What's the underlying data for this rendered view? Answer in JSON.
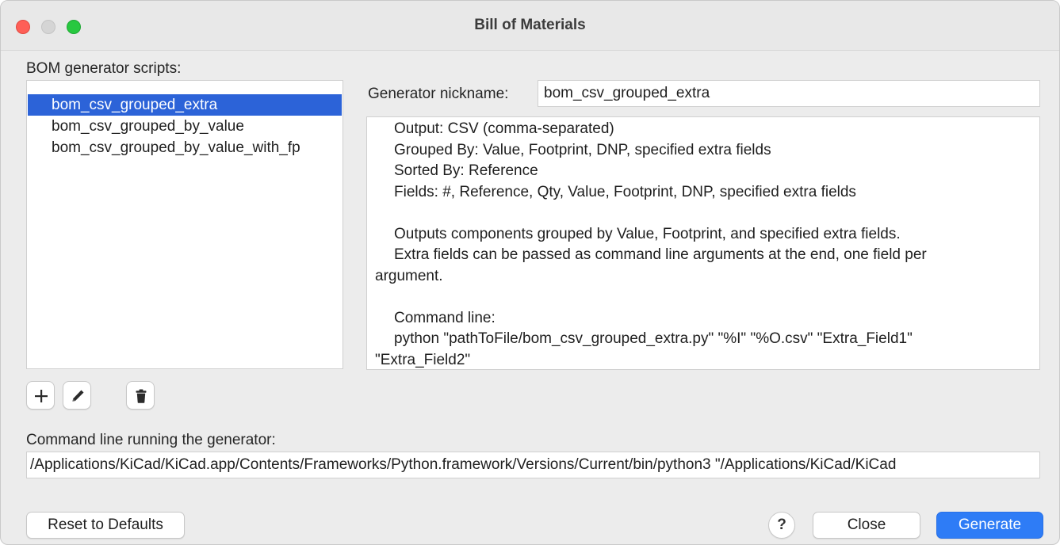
{
  "window": {
    "title": "Bill of Materials"
  },
  "scripts_panel": {
    "label": "BOM generator scripts:",
    "items": [
      {
        "label": "bom_csv_grouped_extra",
        "selected": true
      },
      {
        "label": "bom_csv_grouped_by_value",
        "selected": false
      },
      {
        "label": "bom_csv_grouped_by_value_with_fp",
        "selected": false
      }
    ],
    "buttons": {
      "add_icon": "plus-icon",
      "edit_icon": "pencil-icon",
      "delete_icon": "trash-icon"
    }
  },
  "generator": {
    "nickname_label": "Generator nickname:",
    "nickname_value": "bom_csv_grouped_extra",
    "description_lines": [
      {
        "text": "Output: CSV (comma-separated)",
        "indent": true
      },
      {
        "text": "Grouped By: Value, Footprint, DNP, specified extra fields",
        "indent": true
      },
      {
        "text": "Sorted By: Reference",
        "indent": true
      },
      {
        "text": "Fields: #, Reference, Qty, Value, Footprint, DNP, specified extra fields",
        "indent": true
      },
      {
        "text": "",
        "indent": false
      },
      {
        "text": "Outputs components grouped by Value, Footprint, and specified extra fields.",
        "indent": true
      },
      {
        "text": "Extra fields can be passed as command line arguments at the end, one field per",
        "indent": true
      },
      {
        "text": "argument.",
        "indent": false
      },
      {
        "text": "",
        "indent": false
      },
      {
        "text": "Command line:",
        "indent": true
      },
      {
        "text": "python \"pathToFile/bom_csv_grouped_extra.py\" \"%I\" \"%O.csv\" \"Extra_Field1\"",
        "indent": true
      },
      {
        "text": "\"Extra_Field2\"",
        "indent": false
      }
    ]
  },
  "command": {
    "label": "Command line running the generator:",
    "value": "/Applications/KiCad/KiCad.app/Contents/Frameworks/Python.framework/Versions/Current/bin/python3 \"/Applications/KiCad/KiCad"
  },
  "footer": {
    "reset_label": "Reset to Defaults",
    "help_label": "?",
    "close_label": "Close",
    "generate_label": "Generate"
  },
  "colors": {
    "selection": "#2c63d8",
    "primary_button": "#2e7cf6",
    "traffic_close": "#fe5f57",
    "traffic_minimize": "#d5d5d5",
    "traffic_maximize": "#28c840"
  }
}
